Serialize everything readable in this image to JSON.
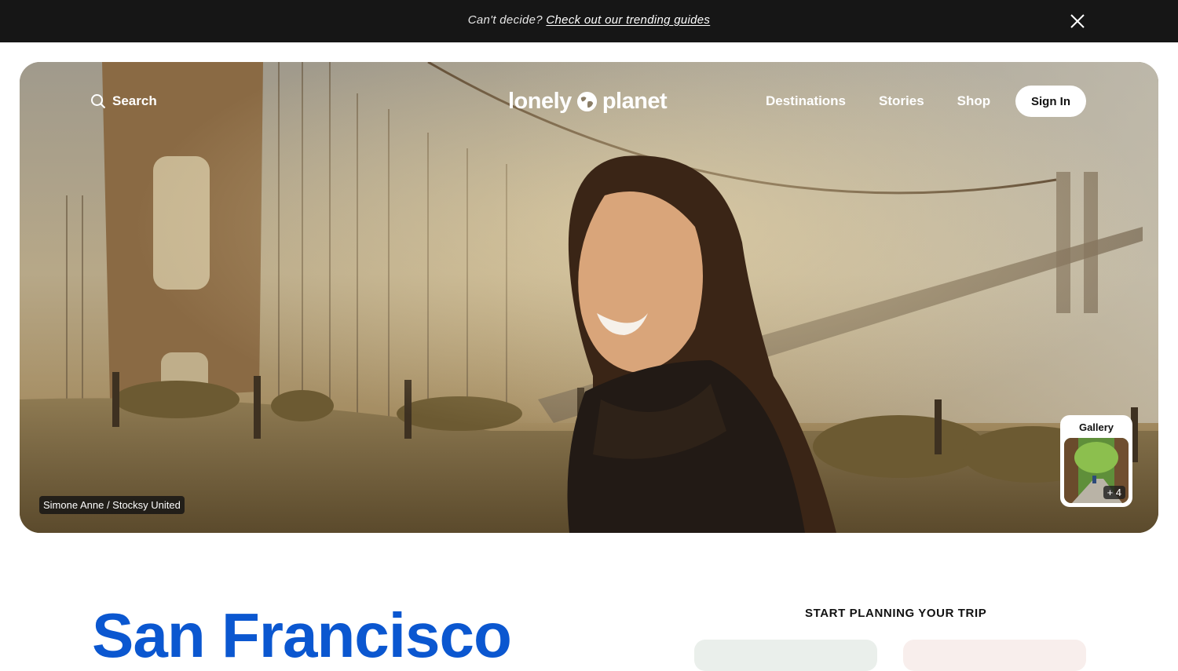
{
  "announcement": {
    "prefix": "Can't decide?",
    "link_text": "Check out our trending guides",
    "close_icon": "close-icon"
  },
  "header": {
    "search_label": "Search",
    "search_icon": "search-icon",
    "logo_left": "lonely",
    "logo_right": "planet",
    "logo_icon": "globe-icon",
    "nav": [
      "Destinations",
      "Stories",
      "Shop"
    ],
    "signin_label": "Sign In"
  },
  "hero": {
    "photo_credit": "Simone Anne / Stocksy United",
    "gallery_label": "Gallery",
    "gallery_count": "+ 4"
  },
  "main": {
    "city_title": "San Francisco",
    "planning_title": "START PLANNING YOUR TRIP"
  },
  "colors": {
    "accent_blue": "#0b57d0",
    "topbar_bg": "#161616"
  }
}
